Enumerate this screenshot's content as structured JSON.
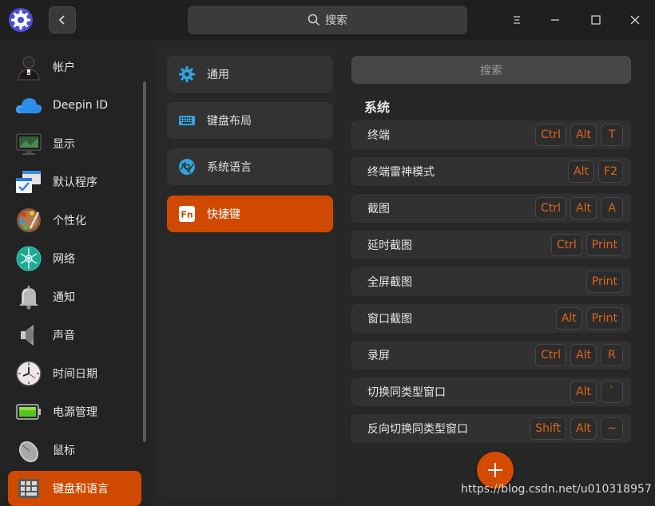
{
  "titlebar": {
    "search_label": "搜索"
  },
  "sidebar": {
    "items": [
      {
        "label": "帐户",
        "icon": "account-icon"
      },
      {
        "label": "Deepin ID",
        "icon": "cloud-icon"
      },
      {
        "label": "显示",
        "icon": "display-icon"
      },
      {
        "label": "默认程序",
        "icon": "default-apps-icon"
      },
      {
        "label": "个性化",
        "icon": "palette-icon"
      },
      {
        "label": "网络",
        "icon": "network-icon"
      },
      {
        "label": "通知",
        "icon": "bell-icon"
      },
      {
        "label": "声音",
        "icon": "speaker-icon"
      },
      {
        "label": "时间日期",
        "icon": "clock-icon"
      },
      {
        "label": "电源管理",
        "icon": "battery-icon"
      },
      {
        "label": "鼠标",
        "icon": "mouse-icon"
      },
      {
        "label": "键盘和语言",
        "icon": "keyboard-language-icon"
      }
    ],
    "active_index": 11
  },
  "middle": {
    "items": [
      {
        "label": "通用",
        "icon": "gear-icon"
      },
      {
        "label": "键盘布局",
        "icon": "keyboard-icon"
      },
      {
        "label": "系统语言",
        "icon": "language-icon"
      },
      {
        "label": "快捷键",
        "icon": "fn-key-icon"
      }
    ],
    "active_index": 3
  },
  "right": {
    "search_placeholder": "搜索",
    "section_title": "系统",
    "shortcuts": [
      {
        "label": "终端",
        "keys": [
          "Ctrl",
          "Alt",
          "T"
        ]
      },
      {
        "label": "终端雷神模式",
        "keys": [
          "Alt",
          "F2"
        ]
      },
      {
        "label": "截图",
        "keys": [
          "Ctrl",
          "Alt",
          "A"
        ]
      },
      {
        "label": "延时截图",
        "keys": [
          "Ctrl",
          "Print"
        ]
      },
      {
        "label": "全屏截图",
        "keys": [
          "Print"
        ]
      },
      {
        "label": "窗口截图",
        "keys": [
          "Alt",
          "Print"
        ]
      },
      {
        "label": "录屏",
        "keys": [
          "Ctrl",
          "Alt",
          "R"
        ]
      },
      {
        "label": "切换同类型窗口",
        "keys": [
          "Alt",
          "`"
        ]
      },
      {
        "label": "反向切换同类型窗口",
        "keys": [
          "Shift",
          "Alt",
          "~"
        ]
      }
    ]
  },
  "watermark": "https://blog.csdn.net/u010318957",
  "colors": {
    "accent": "#cf4a00",
    "key_text": "#e0651b"
  }
}
